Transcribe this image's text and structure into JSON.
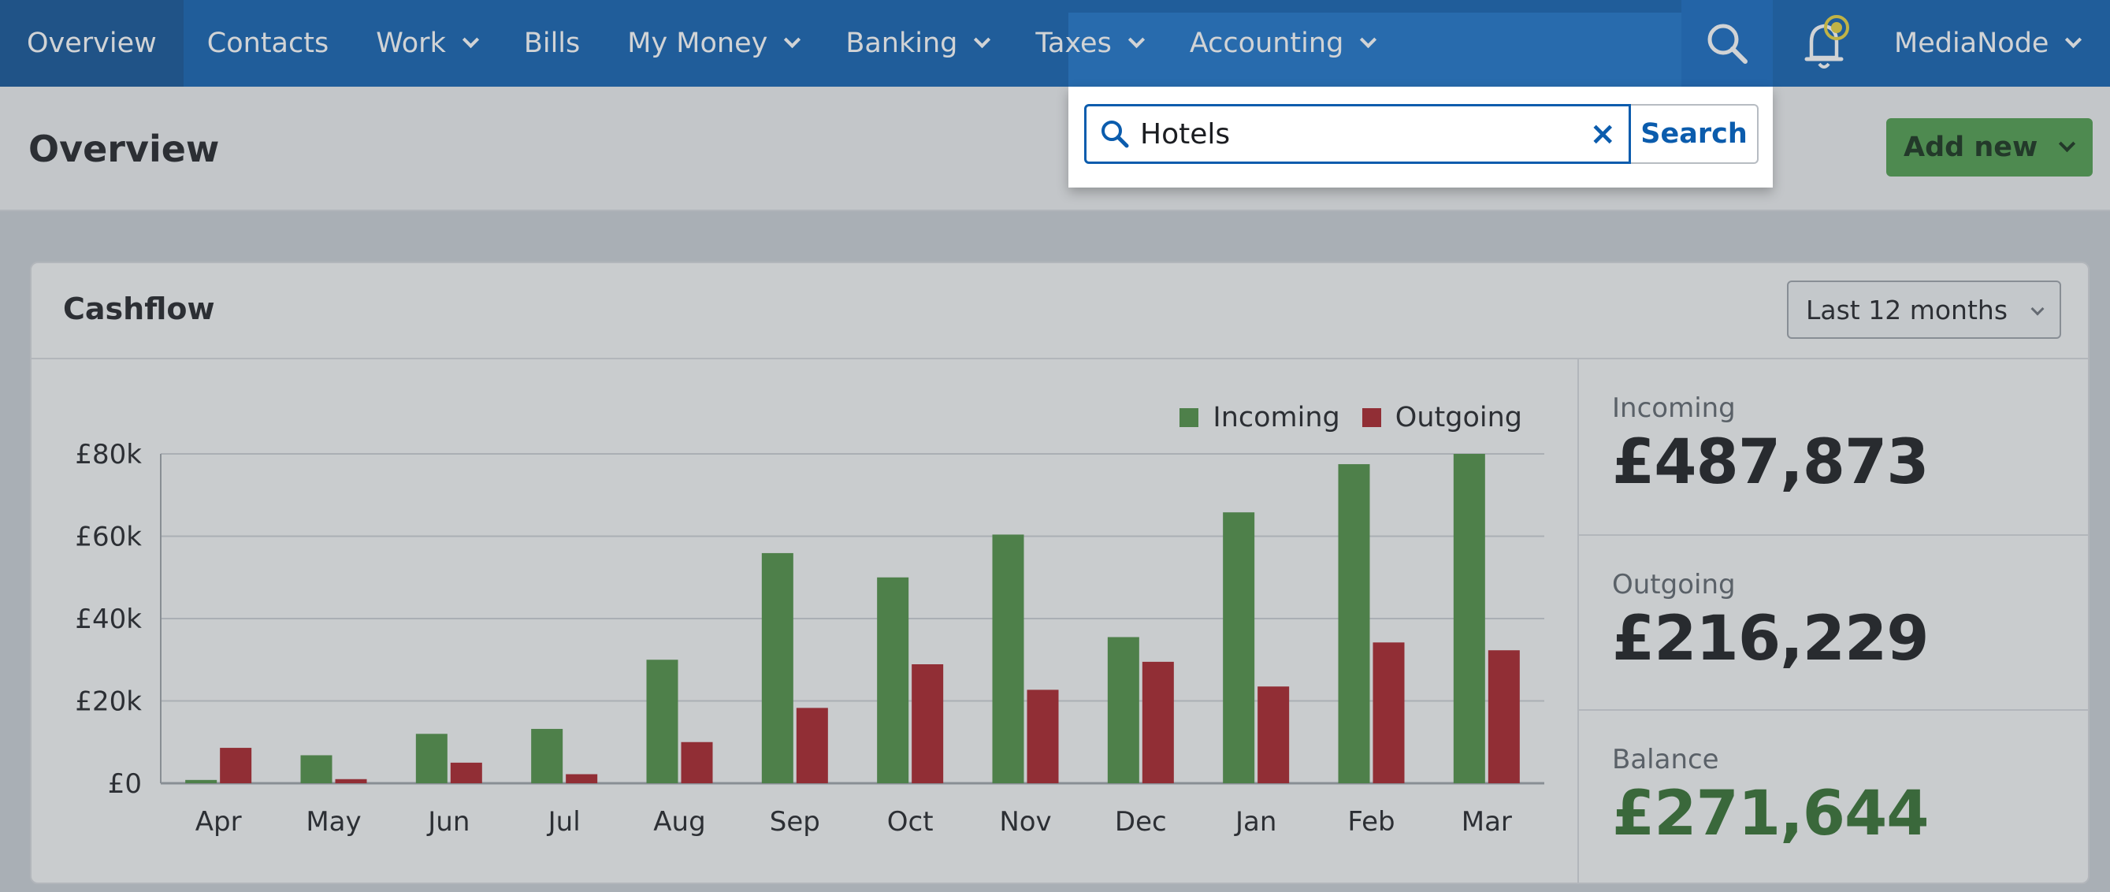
{
  "nav": {
    "items": [
      {
        "label": "Overview"
      },
      {
        "label": "Contacts"
      },
      {
        "label": "Work"
      },
      {
        "label": "Bills"
      },
      {
        "label": "My Money"
      },
      {
        "label": "Banking"
      },
      {
        "label": "Taxes"
      },
      {
        "label": "Accounting"
      }
    ],
    "account": "MediaNode"
  },
  "page": {
    "title": "Overview",
    "add_new": "Add new"
  },
  "search": {
    "value": "Hotels",
    "clear": "×",
    "button": "Search"
  },
  "cashflow": {
    "title": "Cashflow",
    "period": "Last 12 months",
    "stats": {
      "incoming_label": "Incoming",
      "incoming_value": "£487,873",
      "outgoing_label": "Outgoing",
      "outgoing_value": "£216,229",
      "balance_label": "Balance",
      "balance_value": "£271,644"
    }
  },
  "colors": {
    "incoming": "#4a8c3f",
    "outgoing": "#a71b22",
    "nav": "#0b5cad"
  },
  "chart_data": {
    "type": "bar",
    "categories": [
      "Apr",
      "May",
      "Jun",
      "Jul",
      "Aug",
      "Sep",
      "Oct",
      "Nov",
      "Dec",
      "Jan",
      "Feb",
      "Mar"
    ],
    "series": [
      {
        "name": "Incoming",
        "values": [
          800,
          6800,
          12000,
          13200,
          30000,
          55900,
          50000,
          60400,
          35500,
          65800,
          77500,
          80000
        ]
      },
      {
        "name": "Outgoing",
        "values": [
          8600,
          1000,
          5000,
          2200,
          10000,
          18300,
          28900,
          22700,
          29500,
          23500,
          34200,
          32300
        ]
      }
    ],
    "y_ticks": [
      "£0",
      "£20k",
      "£40k",
      "£60k",
      "£80k"
    ],
    "ylim": [
      0,
      80000
    ],
    "legend": "top-right",
    "grid": true
  }
}
